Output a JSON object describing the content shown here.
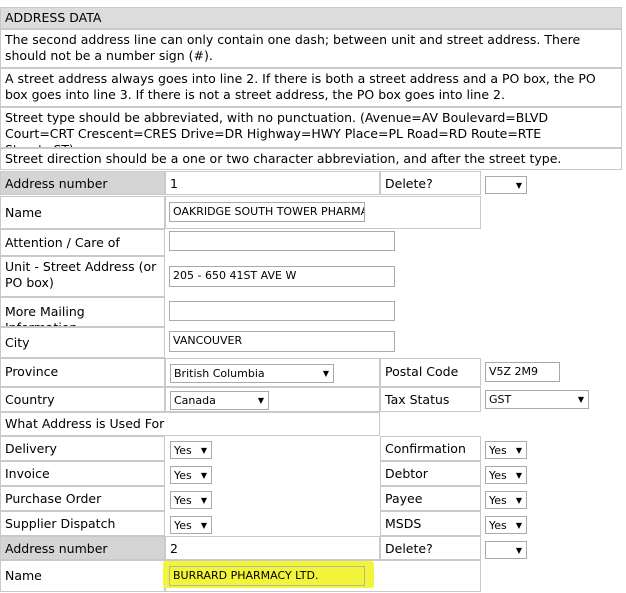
{
  "section_title": "ADDRESS DATA",
  "instructions": [
    "The second address line can only contain one dash; between unit and street address. There should not be a number sign (#).",
    "A street address always goes into line 2. If there is both a street address and a PO box, the PO box goes into line 3. If there is not a street address, the PO box goes into line 2.",
    "Street type should be abbreviated, with no punctuation. (Avenue=AV Boulevard=BLVD Court=CRT Crescent=CRES Drive=DR Highway=HWY Place=PL Road=RD Route=RTE Street=ST).",
    "Street direction should be a one or two character abbreviation, and after the street type."
  ],
  "address1": {
    "number_label": "Address number",
    "number": "1",
    "delete_label": "Delete?",
    "delete_value": "",
    "name_label": "Name",
    "name": "OAKRIDGE SOUTH TOWER PHARMA",
    "attention_label": "Attention / Care of",
    "attention": "",
    "street_label": "Unit - Street Address (or PO box)",
    "street": "205 - 650 41ST AVE W",
    "more_label": "More Mailing Information",
    "more": "",
    "city_label": "City",
    "city": "VANCOUVER",
    "province_label": "Province",
    "province": "British Columbia",
    "postal_label": "Postal Code",
    "postal": "V5Z 2M9",
    "country_label": "Country",
    "country": "Canada",
    "tax_label": "Tax Status",
    "tax": "GST",
    "used_for_label": "What Address is Used For",
    "uses": [
      {
        "left_label": "Delivery",
        "left_value": "Yes",
        "right_label": "Confirmation",
        "right_value": "Yes"
      },
      {
        "left_label": "Invoice",
        "left_value": "Yes",
        "right_label": "Debtor",
        "right_value": "Yes"
      },
      {
        "left_label": "Purchase Order",
        "left_value": "Yes",
        "right_label": "Payee",
        "right_value": "Yes"
      },
      {
        "left_label": "Supplier Dispatch",
        "left_value": "Yes",
        "right_label": "MSDS",
        "right_value": "Yes"
      }
    ]
  },
  "address2": {
    "number_label": "Address number",
    "number": "2",
    "delete_label": "Delete?",
    "delete_value": "",
    "name_label": "Name",
    "name": "BURRARD PHARMACY LTD."
  },
  "colors": {
    "header_bg": "#dcdcdc",
    "label_gray": "#d4d4d4",
    "highlight": "#f3f53a"
  }
}
